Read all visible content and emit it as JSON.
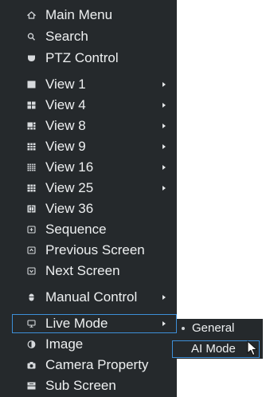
{
  "colors": {
    "menu_bg": "#25292c",
    "text": "#eef0f1",
    "highlight_border": "#3d8fd8"
  },
  "menu": {
    "items": [
      {
        "label": "Main Menu",
        "icon": "home-icon"
      },
      {
        "label": "Search",
        "icon": "search-icon"
      },
      {
        "label": "PTZ Control",
        "icon": "ptz-camera-icon"
      },
      {
        "label": "View 1",
        "icon": "single-view-icon",
        "submenu": true
      },
      {
        "label": "View 4",
        "icon": "four-split-icon",
        "submenu": true
      },
      {
        "label": "View 8",
        "icon": "eight-split-icon",
        "submenu": true
      },
      {
        "label": "View 9",
        "icon": "nine-split-icon",
        "submenu": true
      },
      {
        "label": "View 16",
        "icon": "sixteen-split-icon",
        "submenu": true
      },
      {
        "label": "View 25",
        "icon": "twenty-five-split-icon",
        "submenu": true
      },
      {
        "label": "View 36",
        "icon": "thirty-six-split-icon"
      },
      {
        "label": "Sequence",
        "icon": "sequence-icon"
      },
      {
        "label": "Previous Screen",
        "icon": "previous-screen-icon"
      },
      {
        "label": "Next Screen",
        "icon": "next-screen-icon"
      },
      {
        "label": "Manual Control",
        "icon": "manual-control-icon",
        "submenu": true
      },
      {
        "label": "Live Mode",
        "icon": "live-mode-icon",
        "submenu": true,
        "active": true
      },
      {
        "label": "Image",
        "icon": "image-icon"
      },
      {
        "label": "Camera Property",
        "icon": "camera-icon"
      },
      {
        "label": "Sub Screen",
        "icon": "sub-screen-icon"
      }
    ]
  },
  "live_mode_submenu": {
    "items": [
      {
        "label": "General",
        "selected": true
      },
      {
        "label": "AI Mode",
        "hover": true
      }
    ]
  }
}
